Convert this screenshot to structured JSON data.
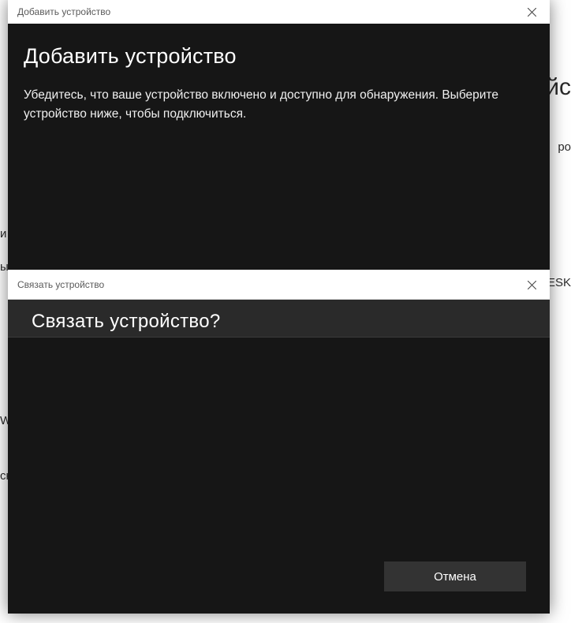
{
  "background_fragments": {
    "frag1": "йс",
    "frag2": "ро",
    "frag3": "и",
    "frag4": "ы",
    "frag5": "ESK",
    "frag6": "Wi",
    "frag7": "сн"
  },
  "main_dialog": {
    "titlebar": "Добавить устройство",
    "heading": "Добавить устройство",
    "description": "Убедитесь, что ваше устройство включено и доступно для обнаружения. Выберите устройство ниже, чтобы подключиться.",
    "cancel_button": "Отмена"
  },
  "secondary_dialog": {
    "titlebar": "Связать устройство",
    "heading": "Связать устройство?"
  }
}
